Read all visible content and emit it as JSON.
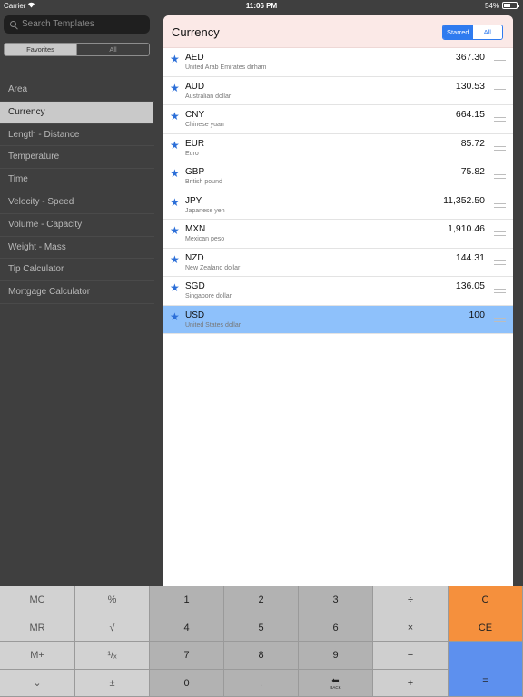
{
  "status": {
    "carrier": "Carrier",
    "time": "11:06 PM",
    "battery": "54%"
  },
  "sidebar": {
    "search_placeholder": "Search Templates",
    "tabs": [
      "Favorites",
      "All"
    ],
    "categories": [
      {
        "label": "Area"
      },
      {
        "label": "Currency",
        "selected": true
      },
      {
        "label": "Length - Distance"
      },
      {
        "label": "Temperature"
      },
      {
        "label": "Time"
      },
      {
        "label": "Velocity - Speed"
      },
      {
        "label": "Volume - Capacity"
      },
      {
        "label": "Weight - Mass"
      },
      {
        "label": "Tip Calculator"
      },
      {
        "label": "Mortgage Calculator"
      }
    ]
  },
  "panel": {
    "title": "Currency",
    "filter": [
      "Starred",
      "All"
    ],
    "rows": [
      {
        "code": "AED",
        "name": "United Arab Emirates dirham",
        "value": "367.30"
      },
      {
        "code": "AUD",
        "name": "Australian dollar",
        "value": "130.53"
      },
      {
        "code": "CNY",
        "name": "Chinese yuan",
        "value": "664.15"
      },
      {
        "code": "EUR",
        "name": "Euro",
        "value": "85.72"
      },
      {
        "code": "GBP",
        "name": "British pound",
        "value": "75.82"
      },
      {
        "code": "JPY",
        "name": "Japanese yen",
        "value": "11,352.50"
      },
      {
        "code": "MXN",
        "name": "Mexican peso",
        "value": "1,910.46"
      },
      {
        "code": "NZD",
        "name": "New Zealand dollar",
        "value": "144.31"
      },
      {
        "code": "SGD",
        "name": "Singapore dollar",
        "value": "136.05"
      },
      {
        "code": "USD",
        "name": "United States dollar",
        "value": "100",
        "selected": true
      }
    ]
  },
  "keypad": {
    "mc": "MC",
    "percent": "%",
    "k1": "1",
    "k2": "2",
    "k3": "3",
    "divide": "÷",
    "clear": "C",
    "mr": "MR",
    "sqrt": "√",
    "k4": "4",
    "k5": "5",
    "k6": "6",
    "multiply": "×",
    "clear_entry": "CE",
    "mplus": "M+",
    "reciprocal": "¹/ₓ",
    "k7": "7",
    "k8": "8",
    "k9": "9",
    "minus": "−",
    "collapse": "⌄",
    "plusminus": "±",
    "k0": "0",
    "decimal": ".",
    "back": "BACK",
    "plus": "+",
    "equals": "="
  },
  "colors": {
    "accent": "#2f7bef",
    "selected_row": "#8ec1fb",
    "orange_key": "#f5903d",
    "equals_key": "#5d90ee",
    "header_bg": "#fbe9e7"
  }
}
